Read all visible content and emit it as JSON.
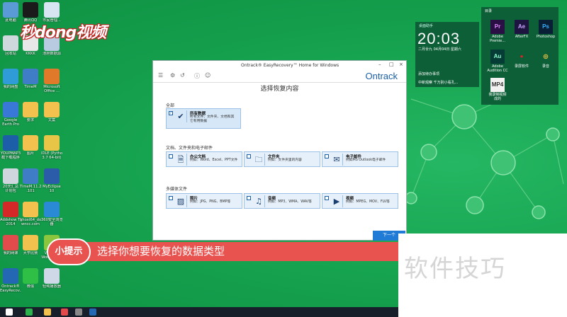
{
  "watermark_top": "秒dong视频",
  "desktop_icons": [
    {
      "label": "此电脑",
      "color": "#5b9bd5"
    },
    {
      "label": "腾讯QQ",
      "color": "#1b1b1b"
    },
    {
      "label": "市民管理...",
      "color": "#d7e4f2"
    },
    {
      "label": "回收站",
      "color": "#cfd8dc"
    },
    {
      "label": "KKKK",
      "color": "#e8e8e8"
    },
    {
      "label": "池胆数据源",
      "color": "#b9cbe0"
    },
    {
      "label": "我的网盘",
      "color": "#2f9bd7"
    },
    {
      "label": "TimeM",
      "color": "#3f7ec7"
    },
    {
      "label": "Microsoft\nOffice ...",
      "color": "#e07a2a"
    },
    {
      "label": "Google\nEarth Pro",
      "color": "#3a78d8"
    },
    {
      "label": "要求",
      "color": "#f2c14e"
    },
    {
      "label": "文案",
      "color": "#f2c14e"
    },
    {
      "label": "YOUPMAP3\n截下载程序",
      "color": "#1c5fa8"
    },
    {
      "label": "图片",
      "color": "#f2c14e"
    },
    {
      "label": "IDLE (Pytho\n3.7 64-bit)",
      "color": "#e8c547"
    },
    {
      "label": "20天汇总\n计划包",
      "color": "#d0d6de"
    },
    {
      "label": "TimeM.11.25\n.101",
      "color": "#3f7ec7"
    },
    {
      "label": "MyEclipse\n10",
      "color": "#2b5caa"
    },
    {
      "label": "Addshow TV\n2014",
      "color": "#d42828"
    },
    {
      "label": "ghost64_do\nwncc.com",
      "color": "#f2c14e"
    },
    {
      "label": "360安全浏览\n器",
      "color": "#2a8ad6"
    },
    {
      "label": "我的网课",
      "color": "#e14b4b"
    },
    {
      "label": "大学比赛",
      "color": "#f2c14e"
    },
    {
      "label": "VMware\nWorkstati...",
      "color": "#8cc63f"
    },
    {
      "label": "Ontrack®\nEasyRecov...",
      "color": "#2468b4"
    },
    {
      "label": "微信",
      "color": "#2fbf46"
    },
    {
      "label": "轻纯播放器",
      "color": "#cfd8e6"
    }
  ],
  "clock_widget": {
    "title": "桌面助手",
    "time": "20:03",
    "date": "二月廿九  04月04日  星期六",
    "add_todo": "添加待办事项",
    "news": "中新观察 千万别小看孔..."
  },
  "apps_widget": {
    "title": "目录",
    "apps": [
      {
        "abbr": "Pr",
        "label": "Adobe\nPremie...",
        "color": "#2a0f45",
        "fg": "#e48bff"
      },
      {
        "abbr": "Ae",
        "label": "AfterFX",
        "color": "#1d1440",
        "fg": "#c9a7ff"
      },
      {
        "abbr": "Ps",
        "label": "Photoshop",
        "color": "#081f35",
        "fg": "#34b3ff"
      },
      {
        "abbr": "Au",
        "label": "Adobe\nAudition CC",
        "color": "#053d36",
        "fg": "#8ffccf"
      },
      {
        "abbr": "●",
        "label": "录屏软件",
        "color": "#0c5f37",
        "fg": "#e22222"
      },
      {
        "abbr": "◎",
        "label": "录音",
        "color": "#0c5f37",
        "fg": "#f4c542"
      },
      {
        "abbr": "MP4",
        "label": "我录制视频\n成的",
        "color": "#f2f2f2",
        "fg": "#333333"
      }
    ]
  },
  "dialog": {
    "title": "Ontrack® EasyRecovery™ Home for Windows",
    "brand": "Ontrack",
    "heading": "选择恢复内容",
    "section_all": "全部",
    "all_card": {
      "title": "所有数据",
      "desc": "所有文件、文件夹、文档和其\n它有用数据"
    },
    "section_docs": "文档、文件夹和电子邮件",
    "doc_cards": [
      {
        "icon": "🗎",
        "title": "办公文档",
        "desc": "例如：Word、Excel、PPT文件"
      },
      {
        "icon": "🗀",
        "title": "文件夹",
        "desc": "例如：文件夹里的内容"
      },
      {
        "icon": "✉",
        "title": "电子邮件",
        "desc": "例如MS Outlook电子邮件"
      }
    ],
    "section_media": "多媒体文件",
    "media_cards": [
      {
        "icon": "▨",
        "title": "照片",
        "desc": "例如：JPG、PNG、BMP等"
      },
      {
        "icon": "♫",
        "title": "音频",
        "desc": "例如：MP3、WMA、WAV等"
      },
      {
        "icon": "▶",
        "title": "视频",
        "desc": "例如：MPEG、MOV、FLV等"
      }
    ],
    "next_label": "下一个"
  },
  "tip": {
    "badge": "小提示",
    "text": "选择你想要恢复的数据类型"
  },
  "watermark_bottom": "软件技巧"
}
